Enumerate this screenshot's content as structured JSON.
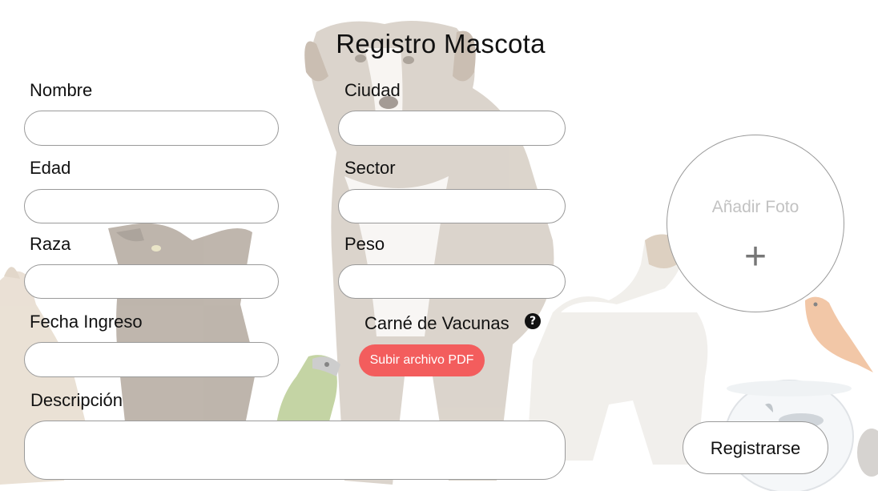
{
  "form": {
    "title": "Registro Mascota",
    "fields": {
      "nombre": {
        "label": "Nombre",
        "value": ""
      },
      "ciudad": {
        "label": "Ciudad",
        "value": ""
      },
      "edad": {
        "label": "Edad",
        "value": ""
      },
      "sector": {
        "label": "Sector",
        "value": ""
      },
      "raza": {
        "label": "Raza",
        "value": ""
      },
      "peso": {
        "label": "Peso",
        "value": ""
      },
      "fecha_ingreso": {
        "label": "Fecha Ingreso",
        "value": ""
      },
      "descripcion": {
        "label": "Descripción",
        "value": ""
      }
    },
    "vaccine": {
      "label": "Carné de Vacunas",
      "help_symbol": "?",
      "upload_label": "Subir archivo PDF"
    },
    "photo": {
      "label": "Añadir Foto",
      "plus_symbol": "+"
    },
    "submit_label": "Registrarse"
  },
  "colors": {
    "upload_button": "#f35d5d",
    "field_border": "#9a9a9a",
    "placeholder_text": "#c2c2c2"
  },
  "background": {
    "icons": [
      "dog-icon",
      "cat-icon",
      "rabbit-icon",
      "parrot-icon",
      "small-dog-icon",
      "canary-icon",
      "fishbowl-icon"
    ]
  }
}
